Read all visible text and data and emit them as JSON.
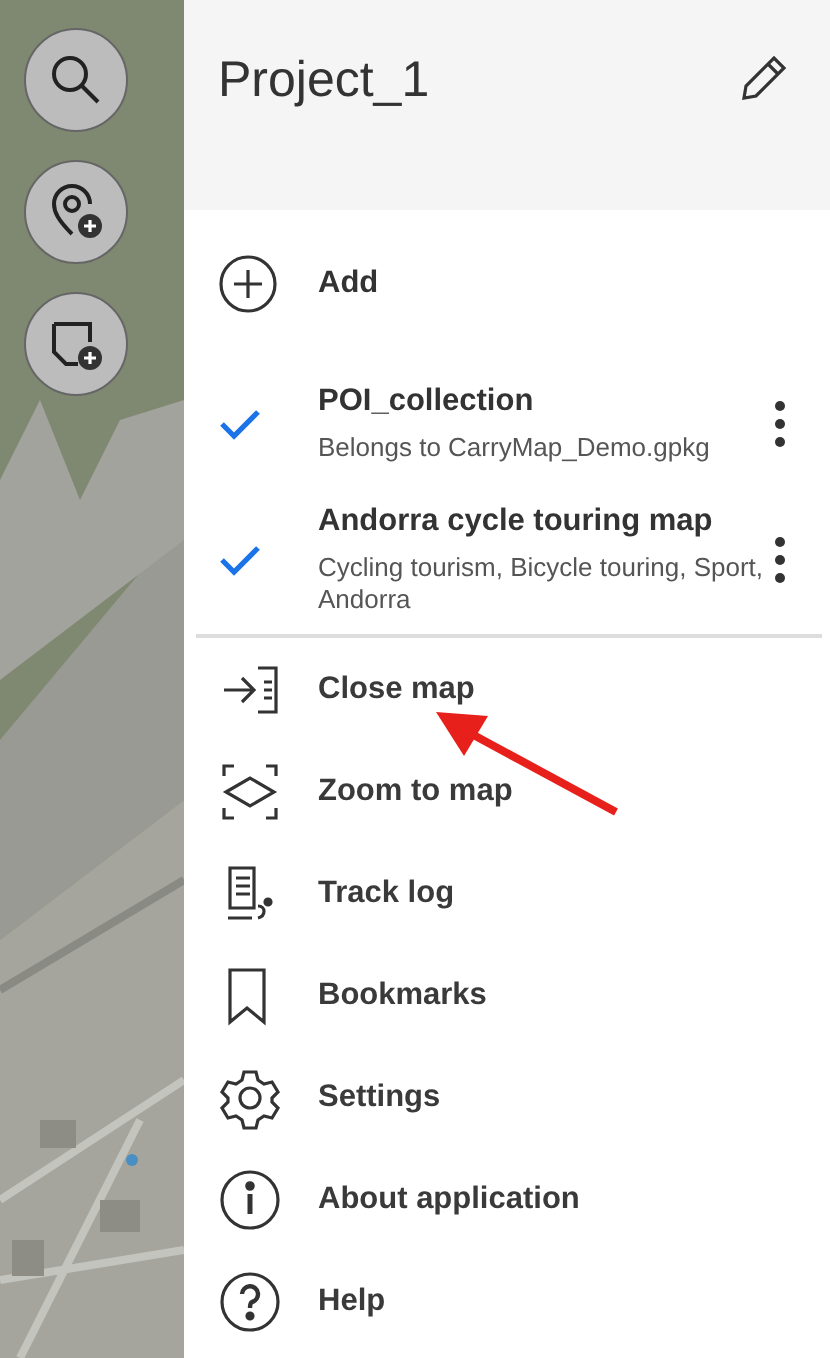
{
  "drawer": {
    "title": "Project_1",
    "add": {
      "label": "Add"
    },
    "layers": [
      {
        "name": "POI_collection",
        "description": "Belongs to CarryMap_Demo.gpkg",
        "checked": true
      },
      {
        "name": "Andorra cycle touring map",
        "description": "Cycling tourism, Bicycle touring, Sport, Andorra",
        "checked": true
      }
    ],
    "menu": [
      {
        "kind": "close",
        "label": "Close map"
      },
      {
        "kind": "zoom",
        "label": "Zoom to map"
      },
      {
        "kind": "track",
        "label": "Track log"
      },
      {
        "kind": "bookmark",
        "label": "Bookmarks"
      },
      {
        "kind": "settings",
        "label": "Settings"
      },
      {
        "kind": "about",
        "label": "About application"
      },
      {
        "kind": "help",
        "label": "Help"
      }
    ]
  },
  "map": {
    "kind": "picture",
    "tools": [
      {
        "kind": "search"
      },
      {
        "kind": "add-poi"
      },
      {
        "kind": "add-note"
      }
    ]
  }
}
